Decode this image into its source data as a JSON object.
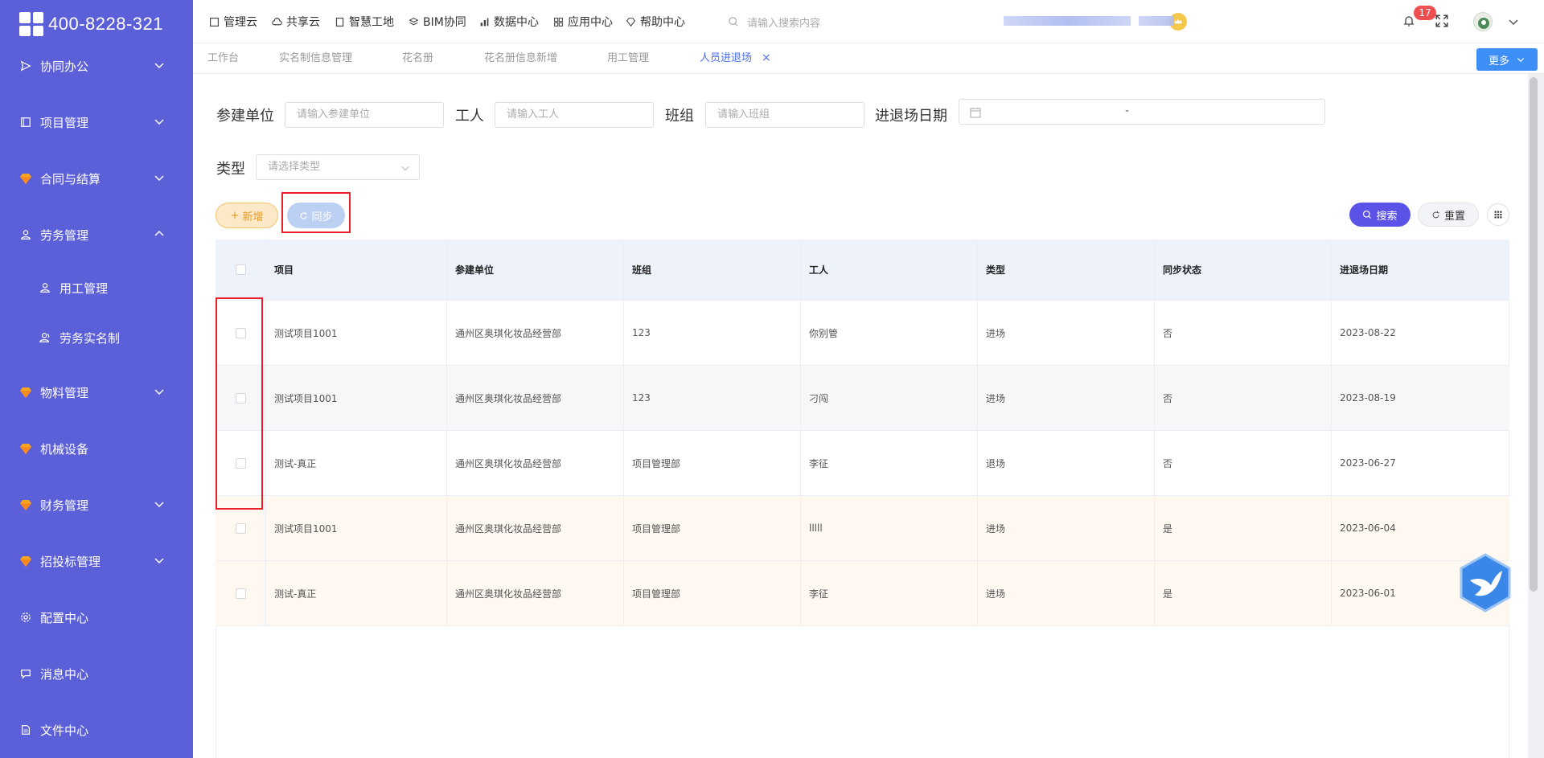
{
  "app": {
    "phone": "400-8228-321"
  },
  "sidebar": {
    "items": [
      {
        "label": "协同办公",
        "icon": "send-icon"
      },
      {
        "label": "项目管理",
        "icon": "book-icon"
      },
      {
        "label": "合同与结算",
        "icon": "gem-icon"
      },
      {
        "label": "劳务管理",
        "icon": "user-icon"
      },
      {
        "label": "用工管理",
        "icon": "user-icon"
      },
      {
        "label": "劳务实名制",
        "icon": "users-icon"
      },
      {
        "label": "物料管理",
        "icon": "gem-icon"
      },
      {
        "label": "机械设备",
        "icon": "gem-icon"
      },
      {
        "label": "财务管理",
        "icon": "gem-icon"
      },
      {
        "label": "招投标管理",
        "icon": "gem-icon"
      },
      {
        "label": "配置中心",
        "icon": "gear-icon"
      },
      {
        "label": "消息中心",
        "icon": "message-icon"
      },
      {
        "label": "文件中心",
        "icon": "file-icon"
      }
    ]
  },
  "topbar": {
    "menu": [
      "管理云",
      "共享云",
      "智慧工地",
      "BIM协同",
      "数据中心",
      "应用中心",
      "帮助中心"
    ],
    "search_placeholder": "请输入搜索内容",
    "notification_count": "17"
  },
  "tabs": [
    "工作台",
    "实名制信息管理",
    "花名册",
    "花名册信息新增",
    "用工管理",
    "人员进退场"
  ],
  "more_label": "更多",
  "filters": {
    "unit_label": "参建单位",
    "unit_placeholder": "请输入参建单位",
    "worker_label": "工人",
    "worker_placeholder": "请输入工人",
    "team_label": "班组",
    "team_placeholder": "请输入班组",
    "date_label": "进退场日期",
    "date_sep": "-",
    "type_label": "类型",
    "type_placeholder": "请选择类型"
  },
  "actions": {
    "add": "新增",
    "sync": "同步",
    "search": "搜索",
    "reset": "重置"
  },
  "table": {
    "headers": [
      "项目",
      "参建单位",
      "班组",
      "工人",
      "类型",
      "同步状态",
      "进退场日期"
    ],
    "rows": [
      [
        "测试项目1001",
        "通州区奥琪化妆品经营部",
        "123",
        "你别管",
        "进场",
        "否",
        "2023-08-22"
      ],
      [
        "测试项目1001",
        "通州区奥琪化妆品经营部",
        "123",
        "刁闯",
        "进场",
        "否",
        "2023-08-19"
      ],
      [
        "测试-真正",
        "通州区奥琪化妆品经营部",
        "项目管理部",
        "李征",
        "退场",
        "否",
        "2023-06-27"
      ],
      [
        "测试项目1001",
        "通州区奥琪化妆品经营部",
        "项目管理部",
        "lllll",
        "进场",
        "是",
        "2023-06-04"
      ],
      [
        "测试-真正",
        "通州区奥琪化妆品经营部",
        "项目管理部",
        "李征",
        "进场",
        "是",
        "2023-06-01"
      ]
    ]
  },
  "colors": {
    "sidebar": "#5b5fd8",
    "accent": "#4a6cf7",
    "search_btn": "#5b53e8",
    "highlight_box": "#e8202a"
  }
}
